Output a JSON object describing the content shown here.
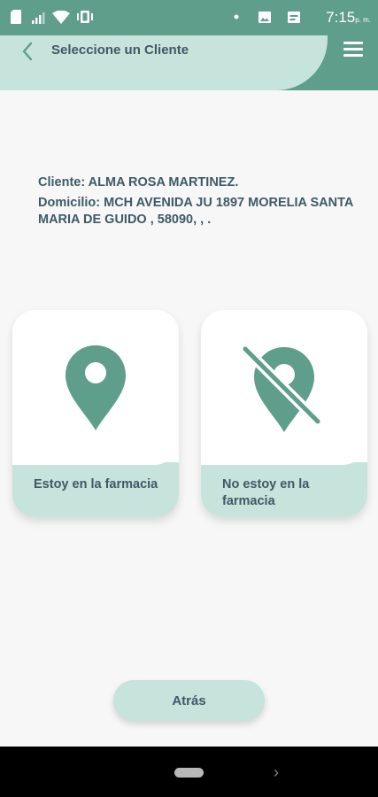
{
  "status_bar": {
    "time": "7:15",
    "ampm": "p. m.",
    "icons": [
      "sd-card-icon",
      "signal-icon",
      "wifi-icon",
      "vibrate-icon",
      "dot-icon",
      "image-icon",
      "calendar-icon"
    ]
  },
  "header": {
    "title": "Seleccione un Cliente"
  },
  "client": {
    "name_line": "Cliente: ALMA ROSA MARTINEZ.",
    "address_line": "Domicilio: MCH AVENIDA JU 1897 MORELIA SANTA MARIA DE GUIDO , 58090, , ."
  },
  "options": [
    {
      "label": "Estoy en la farmacia",
      "icon": "map-pin-icon"
    },
    {
      "label": "No estoy en la farmacia",
      "icon": "map-pin-off-icon"
    }
  ],
  "footer": {
    "back_label": "Atrás"
  },
  "colors": {
    "accent": "#5e9e8a",
    "light_accent": "#c6e3dc",
    "text": "#3d5a66"
  }
}
